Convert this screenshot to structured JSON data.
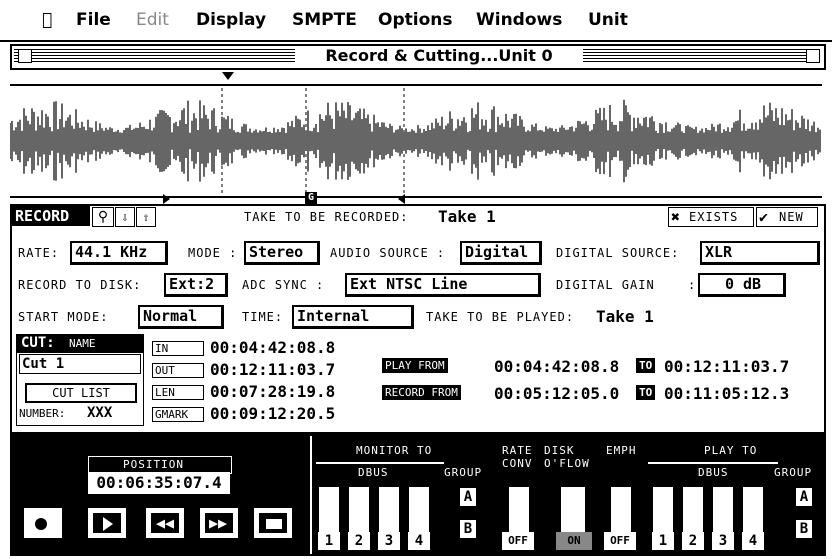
{
  "menu": {
    "apple": "",
    "items": [
      "File",
      "Edit",
      "Display",
      "SMPTE",
      "Options",
      "Windows",
      "Unit"
    ]
  },
  "window": {
    "title": "Record & Cutting...Unit 0"
  },
  "waveform": {
    "marker_label": "G"
  },
  "record": {
    "header": "RECORD",
    "take_label": "TAKE TO BE RECORDED:",
    "take_value": "Take 1",
    "exists_label": "EXISTS",
    "new_label": "NEW",
    "rate_label": "RATE:",
    "rate_value": "44.1 KHz",
    "mode_label": "MODE :",
    "mode_value": "Stereo",
    "audio_source_label": "AUDIO SOURCE :",
    "audio_source_value": "Digital",
    "digital_source_label": "DIGITAL SOURCE:",
    "digital_source_value": "XLR",
    "record_to_disk_label": "RECORD TO DISK:",
    "record_to_disk_value": "Ext:2",
    "adc_sync_label": "ADC SYNC :",
    "adc_sync_value": "Ext NTSC Line",
    "digital_gain_label": "DIGITAL GAIN",
    "digital_gain_value": "0 dB",
    "start_mode_label": "START MODE:",
    "start_mode_value": "Normal",
    "time_label": "TIME:",
    "time_value": "Internal",
    "take_played_label": "TAKE TO BE PLAYED:",
    "take_played_value": "Take 1"
  },
  "cut": {
    "header": "CUT:",
    "name_label": "NAME",
    "name_value": "Cut 1",
    "cut_list_label": "CUT LIST",
    "number_label": "NUMBER:",
    "number_value": "XXX",
    "in_label": "IN",
    "in_value": "00:04:42:08.8",
    "out_label": "OUT",
    "out_value": "00:12:11:03.7",
    "len_label": "LEN",
    "len_value": "00:07:28:19.8",
    "gmark_label": "GMARK",
    "gmark_value": "00:09:12:20.5"
  },
  "play": {
    "play_from_label": "PLAY    FROM",
    "play_from_value": "00:04:42:08.8",
    "to_label": "TO",
    "play_to_value": "00:12:11:03.7",
    "record_from_label": "RECORD FROM",
    "record_from_value": "00:05:12:05.0",
    "record_to_value": "00:11:05:12.3"
  },
  "transport": {
    "position_label": "POSITION",
    "position_value": "00:06:35:07.4"
  },
  "monitor": {
    "title": "MONITOR TO",
    "dbus": "DBUS",
    "group": "GROUP",
    "rate_conv": "RATE CONV",
    "disk_oflow": "DISK O'FLOW",
    "emph": "EMPH",
    "play_to": "PLAY TO",
    "off": "OFF",
    "on": "ON",
    "numbers": [
      "1",
      "2",
      "3",
      "4"
    ],
    "group_a": "A",
    "group_b": "B"
  }
}
